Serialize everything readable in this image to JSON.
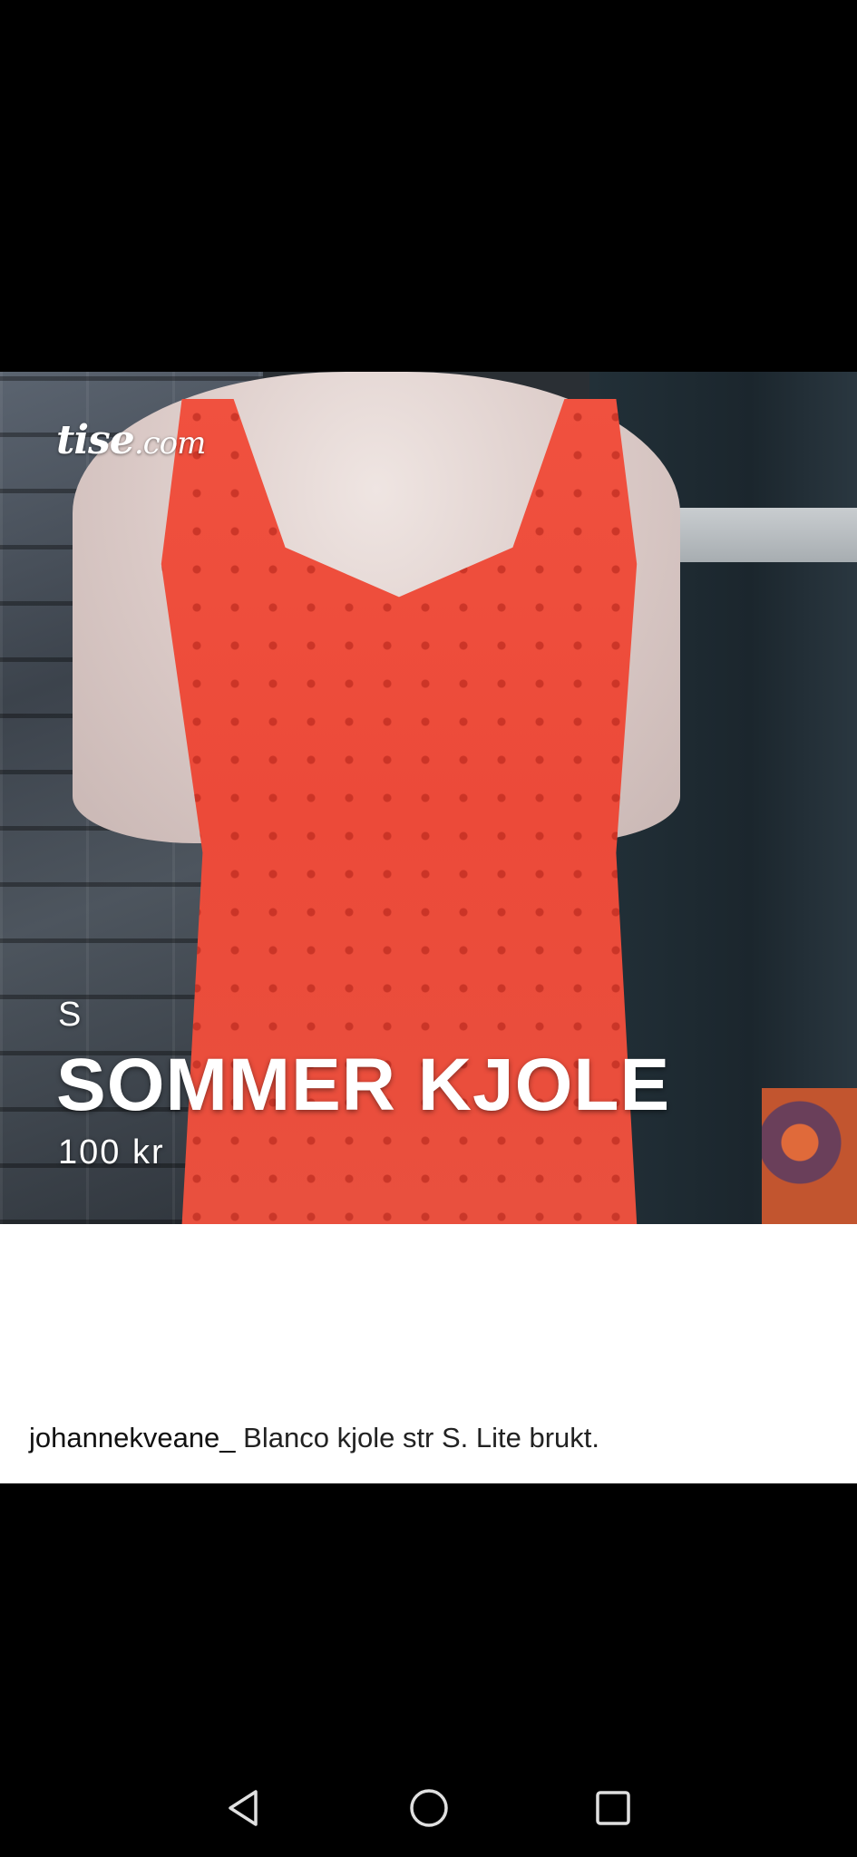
{
  "listing": {
    "logo_brand": "tise",
    "logo_suffix": ".com",
    "size": "S",
    "title": "SOMMER KJOLE",
    "price": "100 kr"
  },
  "caption": {
    "username": "johannekveane_",
    "text": "Blanco kjole str S. Lite brukt."
  },
  "nav": {
    "back_icon": "triangle-back-icon",
    "home_icon": "circle-home-icon",
    "recents_icon": "square-recents-icon"
  },
  "colors": {
    "dress": "#EC4A39",
    "background": "#000000",
    "caption_bg": "#FFFFFF",
    "nav_icon": "#E0E0E0"
  }
}
